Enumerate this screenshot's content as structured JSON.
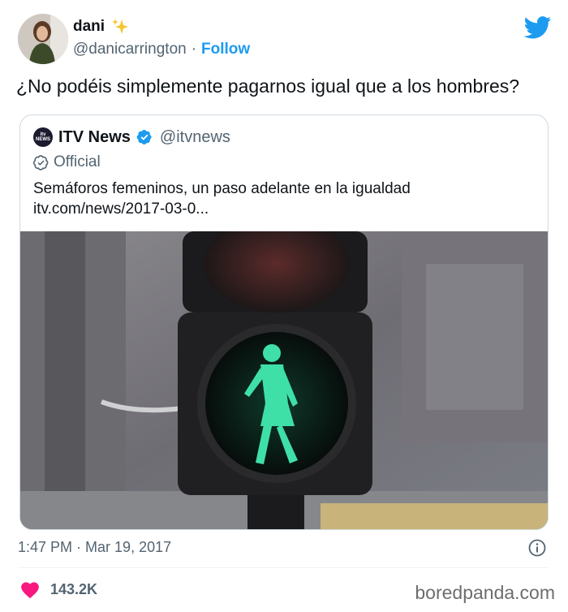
{
  "user": {
    "name": "dani",
    "handle": "@danicarrington",
    "separator": "·",
    "follow_label": "Follow"
  },
  "tweet": {
    "text": "¿No podéis simplemente pagarnos igual que a los hombres?"
  },
  "quoted": {
    "logo_text": "itv NEWS",
    "name": "ITV News",
    "handle": "@itvnews",
    "official_label": "Official",
    "text_line1": "Semáforos femeninos, un paso adelante en la igualdad",
    "text_line2": "itv.com/news/2017-03-0..."
  },
  "meta": {
    "time": "1:47 PM",
    "separator": "·",
    "date": "Mar 19, 2017"
  },
  "engagement": {
    "likes": "143.2K"
  },
  "watermark": "boredpanda.com",
  "colors": {
    "accent": "#1d9bf0",
    "heart": "#f91880",
    "signal_green": "#3fe0a8"
  },
  "icons": [
    "sparkles-icon",
    "twitter-bird-icon",
    "verified-badge-icon",
    "official-check-icon",
    "info-icon",
    "heart-icon"
  ]
}
